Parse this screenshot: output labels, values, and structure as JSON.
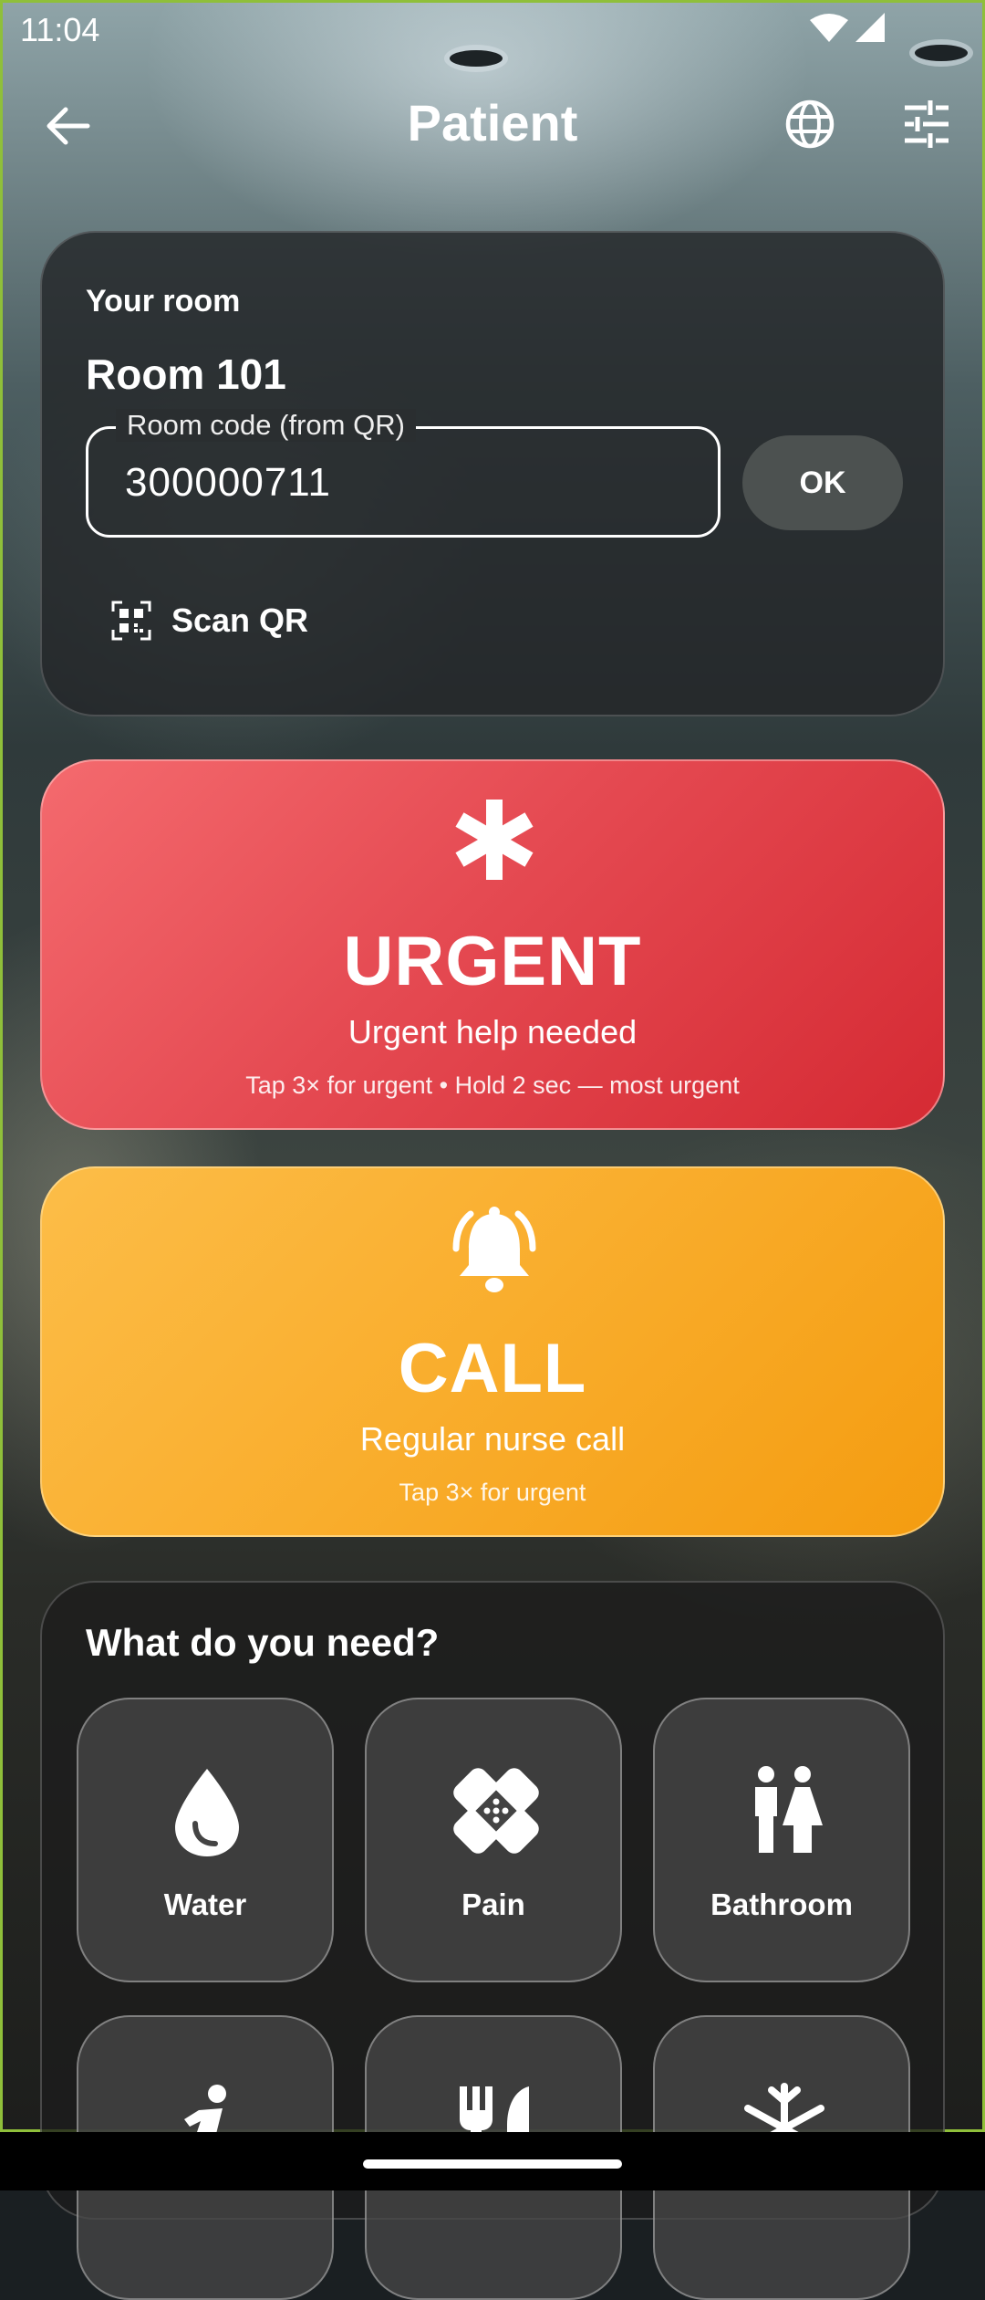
{
  "status_bar": {
    "time": "11:04"
  },
  "app_bar": {
    "title": "Patient"
  },
  "room_card": {
    "label": "Your room",
    "room_name": "Room 101",
    "code_field_label": "Room code (from QR)",
    "code_value": "300000711",
    "ok_label": "OK",
    "scan_label": "Scan QR"
  },
  "urgent": {
    "title": "URGENT",
    "subtitle": "Urgent help needed",
    "hint": "Tap 3× for urgent • Hold 2 sec — most urgent",
    "color": "#e54a52",
    "icon": "asterisk-icon"
  },
  "call": {
    "title": "CALL",
    "subtitle": "Regular nurse call",
    "hint": "Tap 3× for urgent",
    "color": "#f9ad2c",
    "icon": "bell-icon"
  },
  "needs": {
    "title": "What do you need?",
    "items": [
      {
        "label": "Water",
        "icon": "water-drop-icon"
      },
      {
        "label": "Pain",
        "icon": "bandage-icon"
      },
      {
        "label": "Bathroom",
        "icon": "restroom-icon"
      },
      {
        "label": "",
        "icon": "walking-icon"
      },
      {
        "label": "",
        "icon": "food-icon"
      },
      {
        "label": "",
        "icon": "cold-icon"
      }
    ]
  }
}
